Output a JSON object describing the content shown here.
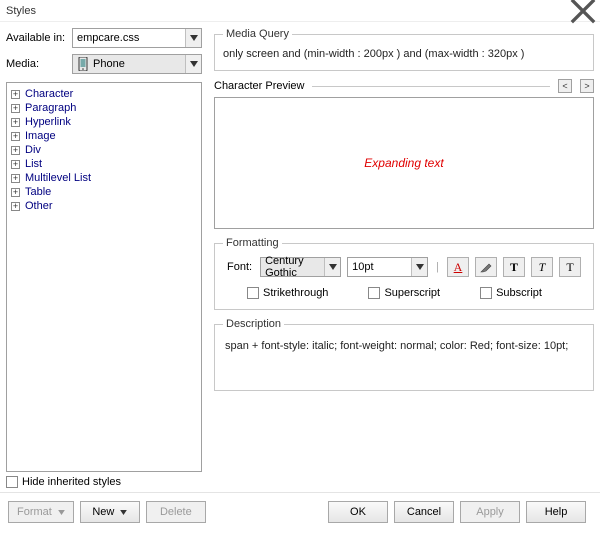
{
  "window": {
    "title": "Styles"
  },
  "left": {
    "available_label": "Available in:",
    "available_value": "empcare.css",
    "media_label": "Media:",
    "media_value": "Phone"
  },
  "tree": {
    "items": [
      "Character",
      "Paragraph",
      "Hyperlink",
      "Image",
      "Div",
      "List",
      "Multilevel List",
      "Table",
      "Other"
    ]
  },
  "hide_inherited_label": "Hide inherited styles",
  "media_query": {
    "legend": "Media Query",
    "text": "only screen and (min-width : 200px ) and (max-width : 320px )"
  },
  "preview": {
    "label": "Character Preview",
    "text": "Expanding text"
  },
  "formatting": {
    "legend": "Formatting",
    "font_label": "Font:",
    "font_value": "Century Gothic",
    "size_value": "10pt",
    "strike_label": "Strikethrough",
    "super_label": "Superscript",
    "sub_label": "Subscript"
  },
  "description": {
    "legend": "Description",
    "text": "span + font-style: italic;  font-weight: normal;  color: Red;  font-size: 10pt;"
  },
  "footer": {
    "format": "Format",
    "new": "New",
    "delete": "Delete",
    "ok": "OK",
    "cancel": "Cancel",
    "apply": "Apply",
    "help": "Help"
  }
}
